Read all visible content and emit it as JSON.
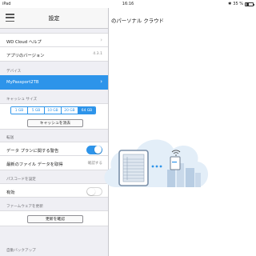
{
  "status_bar": {
    "carrier": "iPad",
    "time": "16:16",
    "battery_text": "35 %",
    "battery_level": 0.35
  },
  "settings": {
    "title": "設定",
    "wd_cloud_help": "WD Cloud ヘルプ",
    "app_version_label": "アプリのバージョン",
    "app_version_value": "4.3.1",
    "device_header": "デバイス",
    "device_name": "MyPassport2TB",
    "cache_size_header": "キャッシュ サイズ",
    "cache_sizes": [
      "1 GB",
      "5 GB",
      "10 GB",
      "20 GB",
      "64 GB"
    ],
    "cache_selected_index": 4,
    "clear_cache_button": "キャッシュを消去",
    "transfer_header": "転送",
    "data_plan_warning_label": "データ プランに関する警告",
    "data_plan_warning_on": true,
    "latest_file_data_label": "最新のファイル データを取得",
    "latest_file_data_value": "確認する",
    "passcode_header": "パスコードを設定",
    "passcode_enabled_label": "有効",
    "passcode_enabled_on": false,
    "firmware_header": "ファームウェアを更新",
    "check_update_button": "更新を確認",
    "auto_backup_header": "自動バックアップ"
  },
  "main": {
    "title": "のパーソナル クラウド"
  },
  "colors": {
    "accent": "#2d94ea",
    "cloud": "#e3eef8",
    "building": "#b8cde3"
  }
}
